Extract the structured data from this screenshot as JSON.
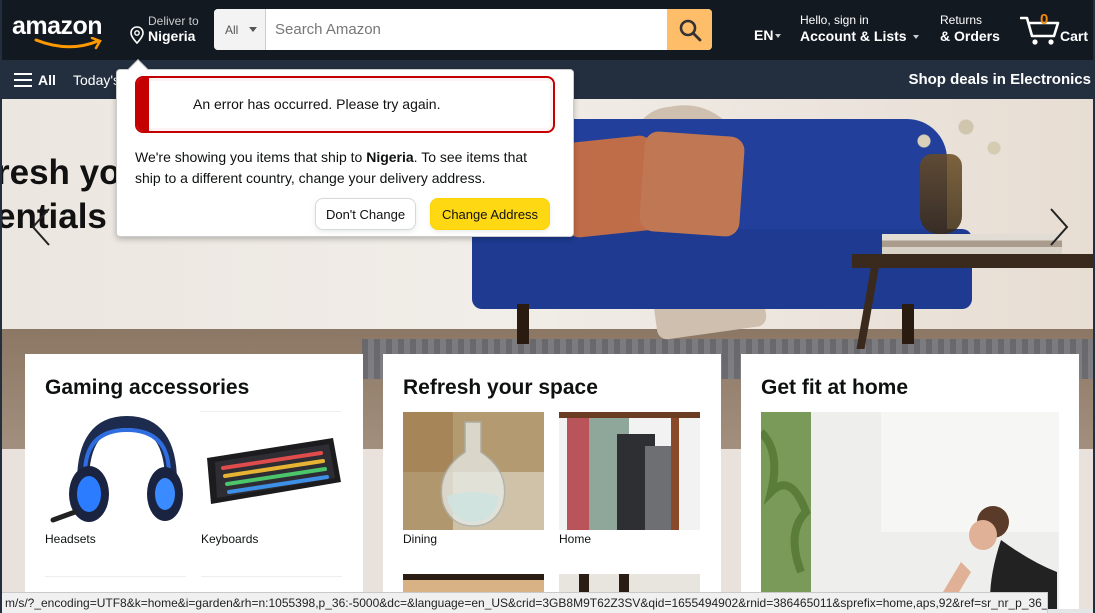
{
  "nav": {
    "logo": "amazon",
    "deliver_to": "Deliver to",
    "deliver_country": "Nigeria",
    "search_dept": "All",
    "search_placeholder": "Search Amazon",
    "lang": "EN",
    "account_line1": "Hello, sign in",
    "account_line2": "Account & Lists",
    "orders_line1": "Returns",
    "orders_line2": "& Orders",
    "cart_count": "0",
    "cart_label": "Cart"
  },
  "subnav": {
    "all": "All",
    "today": "Today's",
    "deals": "Shop deals in Electronics"
  },
  "hero": {
    "line1": "resh yo",
    "line2": "entials n"
  },
  "popover": {
    "error": "An error has occurred. Please try again.",
    "msg_pre": "We're showing you items that ship to ",
    "msg_country": "Nigeria",
    "msg_post": ". To see items that ship to a different country, change your delivery address.",
    "dont_change": "Don't Change",
    "change_address": "Change Address"
  },
  "cards": [
    {
      "title": "Gaming accessories",
      "items": [
        "Headsets",
        "Keyboards"
      ]
    },
    {
      "title": "Refresh your space",
      "items": [
        "Dining",
        "Home"
      ]
    },
    {
      "title": "Get fit at home"
    }
  ],
  "status_url": "m/s/?_encoding=UTF8&k=home&i=garden&rh=n:1055398,p_36:-5000&dc=&language=en_US&crid=3GB8M9T62Z3SV&qid=1655494902&rnid=386465011&sprefix=home,aps,92&ref=sr_nr_p_36_5",
  "colors": {
    "nav_bg": "#131921",
    "subnav_bg": "#232f3e",
    "search_button": "#febd69",
    "change_button": "#ffd814",
    "alert_red": "#c40000",
    "cart_count": "#f08804"
  }
}
